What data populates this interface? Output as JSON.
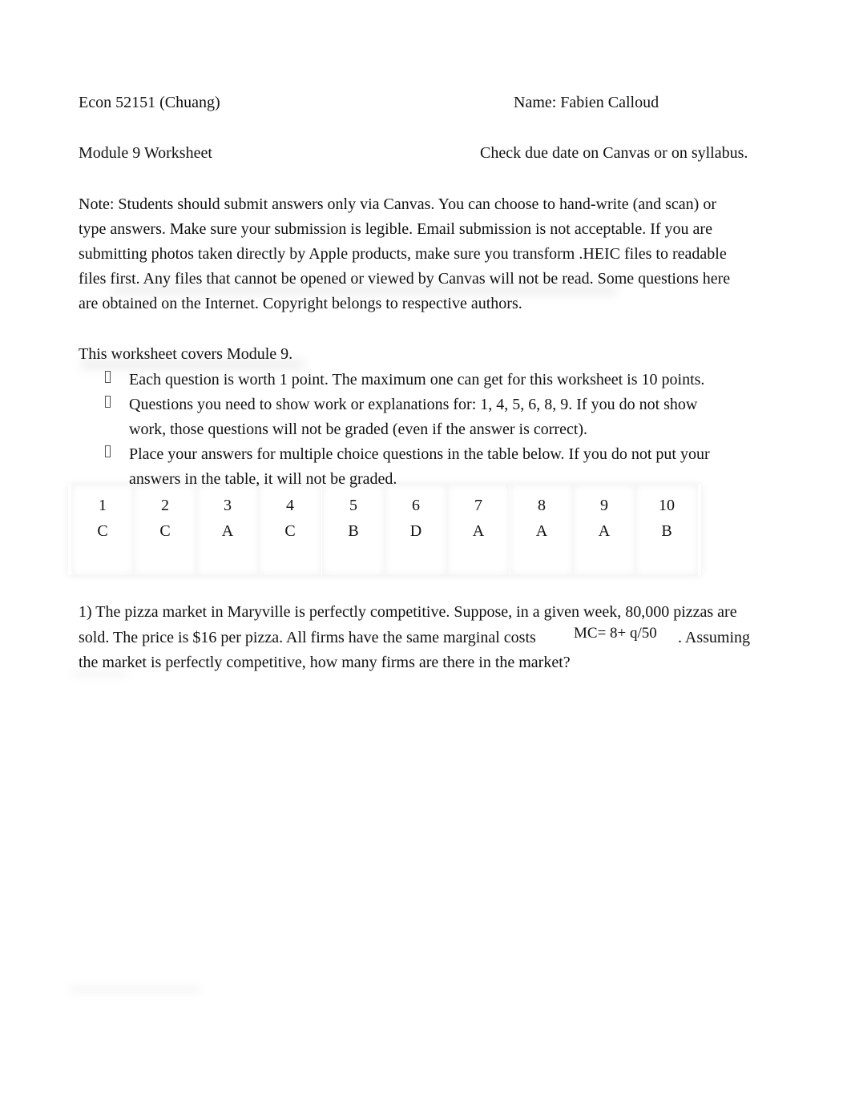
{
  "header": {
    "course": "Econ 52151 (Chuang)",
    "name": "Name: Fabien Calloud",
    "module": "Module 9 Worksheet",
    "due": "Check due date on Canvas or on syllabus."
  },
  "note": {
    "lines": [
      "Note: Students should submit answers only via Canvas. You can choose to hand-write (and scan) or",
      "type answers. Make sure your submission is legible. Email submission is not acceptable. If you are",
      "submitting photos taken directly by Apple products, make sure you transform .HEIC files to readable",
      "files first. Any files that cannot be opened or viewed by Canvas will not be read. Some questions here",
      "are obtained on the Internet. Copyright belongs to respective authors."
    ]
  },
  "coverage": {
    "intro": "This worksheet covers Module 9.",
    "bullets": [
      {
        "lines": [
          "Each question is worth 1 point. The maximum one can get for this worksheet is 10 points."
        ]
      },
      {
        "lines": [
          "Questions you need to show work or explanations for: 1, 4, 5, 6, 8, 9. If you do not show",
          "work, those questions will not be graded (even if the answer is correct)."
        ]
      },
      {
        "lines": [
          "Place your answers for multiple choice questions in the table below. If you do not put your",
          "answers in the table, it will not be graded."
        ]
      }
    ]
  },
  "answer_table": {
    "questions": [
      "1",
      "2",
      "3",
      "4",
      "5",
      "6",
      "7",
      "8",
      "9",
      "10"
    ],
    "answers": [
      "C",
      "C",
      "A",
      "C",
      "B",
      "D",
      "A",
      "A",
      "A",
      "B"
    ]
  },
  "question1": {
    "line1": "1) The pizza market in Maryville is perfectly competitive. Suppose, in a given week, 80,000 pizzas are",
    "line2_before": "sold. The price is $16 per pizza. All firms have the same marginal costs",
    "formula": "MC= 8+ q/50",
    "line2_after": ". Assuming",
    "line3": "the market is perfectly competitive, how many firms are there in the market?"
  }
}
